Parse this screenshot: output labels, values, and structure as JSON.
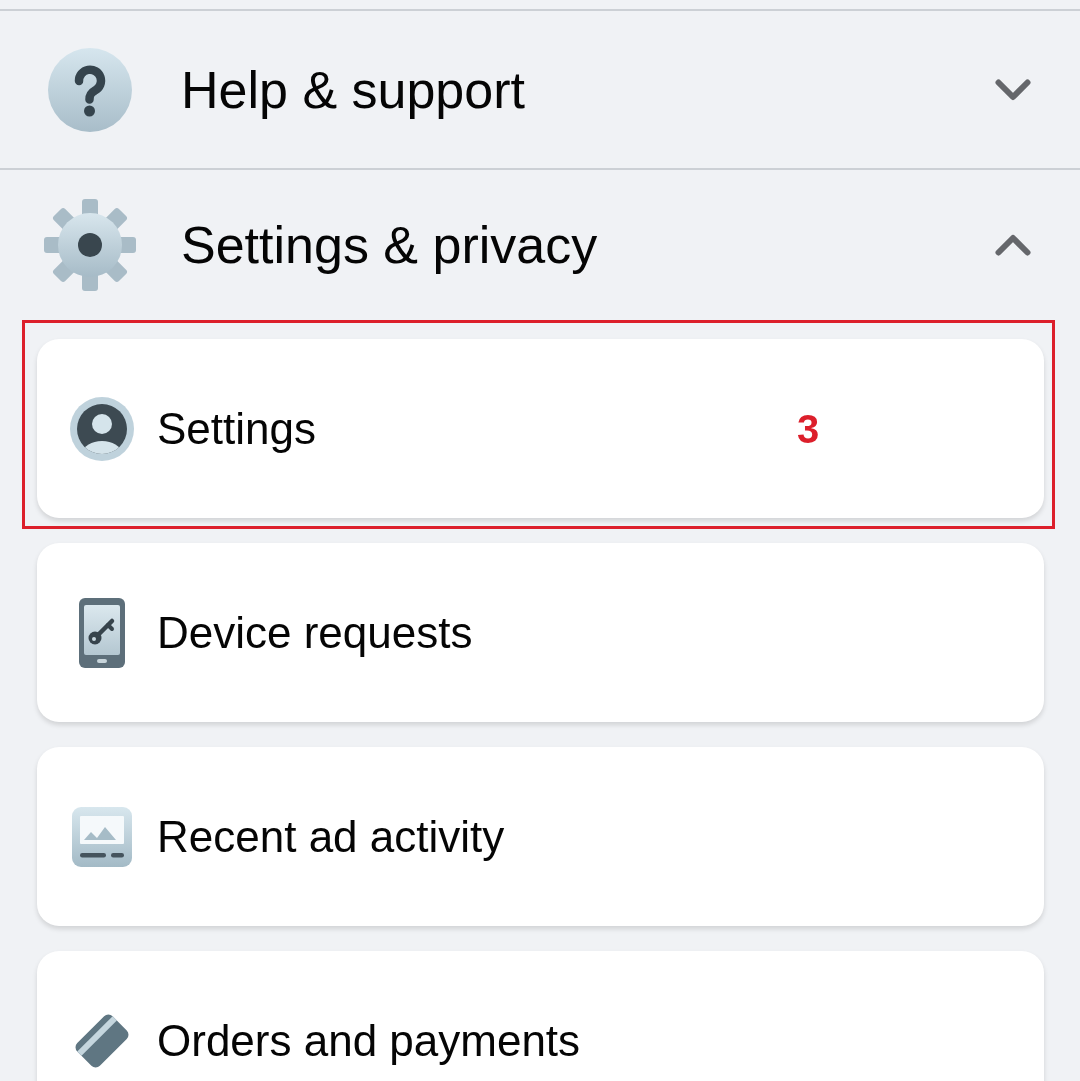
{
  "sections": [
    {
      "title": "Help & support",
      "expanded": false
    },
    {
      "title": "Settings & privacy",
      "expanded": true,
      "items": [
        {
          "label": "Settings",
          "highlighted": true,
          "annotation": "3"
        },
        {
          "label": "Device requests",
          "highlighted": false
        },
        {
          "label": "Recent ad activity",
          "highlighted": false
        },
        {
          "label": "Orders and payments",
          "highlighted": false
        }
      ]
    }
  ]
}
